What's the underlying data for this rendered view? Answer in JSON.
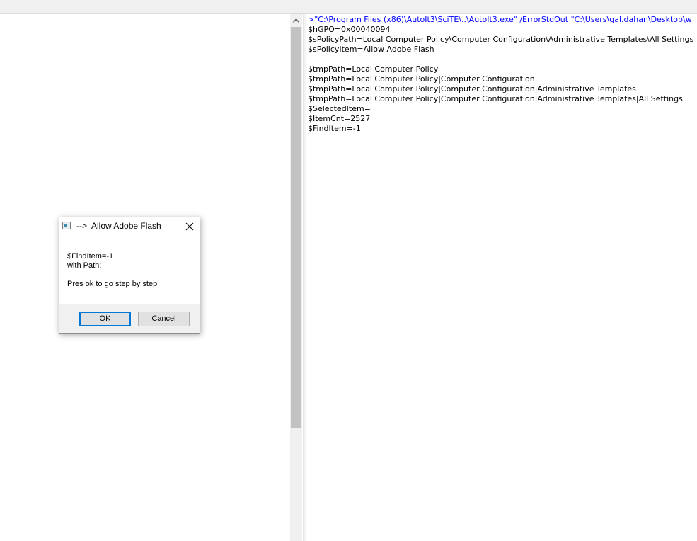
{
  "output": {
    "lines": [
      {
        "text": ">\"C:\\Program Files (x86)\\AutoIt3\\SciTE\\..\\AutoIt3.exe\" /ErrorStdOut \"C:\\Users\\gal.dahan\\Desktop\\w",
        "type": "cmd"
      },
      {
        "text": "$hGPO=0x00040094",
        "type": "normal"
      },
      {
        "text": "$sPolicyPath=Local Computer Policy\\Computer Configuration\\Administrative Templates\\All Settings",
        "type": "normal"
      },
      {
        "text": "$sPolicyItem=Allow Adobe Flash",
        "type": "normal"
      },
      {
        "text": "",
        "type": "normal"
      },
      {
        "text": "$tmpPath=Local Computer Policy",
        "type": "normal"
      },
      {
        "text": "$tmpPath=Local Computer Policy|Computer Configuration",
        "type": "normal"
      },
      {
        "text": "$tmpPath=Local Computer Policy|Computer Configuration|Administrative Templates",
        "type": "normal"
      },
      {
        "text": "$tmpPath=Local Computer Policy|Computer Configuration|Administrative Templates|All Settings",
        "type": "normal"
      },
      {
        "text": "$SelectedItem=",
        "type": "normal"
      },
      {
        "text": "$ItemCnt=2527",
        "type": "normal"
      },
      {
        "text": "$FindItem=-1",
        "type": "normal"
      }
    ],
    "cmd_color": "#0000ff",
    "text_color": "#000000"
  },
  "scrollbar": {
    "up_arrow_icon": "chevron-up-icon"
  },
  "dialog": {
    "title": "-->  Allow Adobe Flash",
    "app_icon": "window-app-icon",
    "close_icon": "close-x-icon",
    "message_lines": [
      "$FindItem=-1",
      "with Path:",
      "",
      "Pres ok to go step by step"
    ],
    "ok_label": "OK",
    "cancel_label": "Cancel",
    "focus_color": "#0078d7"
  }
}
